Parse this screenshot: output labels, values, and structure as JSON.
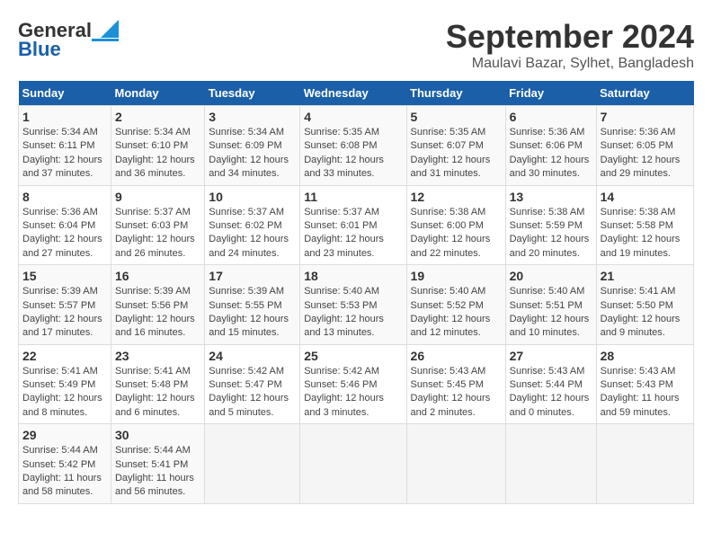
{
  "header": {
    "logo_general": "General",
    "logo_blue": "Blue",
    "title": "September 2024",
    "subtitle": "Maulavi Bazar, Sylhet, Bangladesh"
  },
  "days_of_week": [
    "Sunday",
    "Monday",
    "Tuesday",
    "Wednesday",
    "Thursday",
    "Friday",
    "Saturday"
  ],
  "weeks": [
    [
      {
        "day": "1",
        "sunrise": "Sunrise: 5:34 AM",
        "sunset": "Sunset: 6:11 PM",
        "daylight": "Daylight: 12 hours and 37 minutes."
      },
      {
        "day": "2",
        "sunrise": "Sunrise: 5:34 AM",
        "sunset": "Sunset: 6:10 PM",
        "daylight": "Daylight: 12 hours and 36 minutes."
      },
      {
        "day": "3",
        "sunrise": "Sunrise: 5:34 AM",
        "sunset": "Sunset: 6:09 PM",
        "daylight": "Daylight: 12 hours and 34 minutes."
      },
      {
        "day": "4",
        "sunrise": "Sunrise: 5:35 AM",
        "sunset": "Sunset: 6:08 PM",
        "daylight": "Daylight: 12 hours and 33 minutes."
      },
      {
        "day": "5",
        "sunrise": "Sunrise: 5:35 AM",
        "sunset": "Sunset: 6:07 PM",
        "daylight": "Daylight: 12 hours and 31 minutes."
      },
      {
        "day": "6",
        "sunrise": "Sunrise: 5:36 AM",
        "sunset": "Sunset: 6:06 PM",
        "daylight": "Daylight: 12 hours and 30 minutes."
      },
      {
        "day": "7",
        "sunrise": "Sunrise: 5:36 AM",
        "sunset": "Sunset: 6:05 PM",
        "daylight": "Daylight: 12 hours and 29 minutes."
      }
    ],
    [
      {
        "day": "8",
        "sunrise": "Sunrise: 5:36 AM",
        "sunset": "Sunset: 6:04 PM",
        "daylight": "Daylight: 12 hours and 27 minutes."
      },
      {
        "day": "9",
        "sunrise": "Sunrise: 5:37 AM",
        "sunset": "Sunset: 6:03 PM",
        "daylight": "Daylight: 12 hours and 26 minutes."
      },
      {
        "day": "10",
        "sunrise": "Sunrise: 5:37 AM",
        "sunset": "Sunset: 6:02 PM",
        "daylight": "Daylight: 12 hours and 24 minutes."
      },
      {
        "day": "11",
        "sunrise": "Sunrise: 5:37 AM",
        "sunset": "Sunset: 6:01 PM",
        "daylight": "Daylight: 12 hours and 23 minutes."
      },
      {
        "day": "12",
        "sunrise": "Sunrise: 5:38 AM",
        "sunset": "Sunset: 6:00 PM",
        "daylight": "Daylight: 12 hours and 22 minutes."
      },
      {
        "day": "13",
        "sunrise": "Sunrise: 5:38 AM",
        "sunset": "Sunset: 5:59 PM",
        "daylight": "Daylight: 12 hours and 20 minutes."
      },
      {
        "day": "14",
        "sunrise": "Sunrise: 5:38 AM",
        "sunset": "Sunset: 5:58 PM",
        "daylight": "Daylight: 12 hours and 19 minutes."
      }
    ],
    [
      {
        "day": "15",
        "sunrise": "Sunrise: 5:39 AM",
        "sunset": "Sunset: 5:57 PM",
        "daylight": "Daylight: 12 hours and 17 minutes."
      },
      {
        "day": "16",
        "sunrise": "Sunrise: 5:39 AM",
        "sunset": "Sunset: 5:56 PM",
        "daylight": "Daylight: 12 hours and 16 minutes."
      },
      {
        "day": "17",
        "sunrise": "Sunrise: 5:39 AM",
        "sunset": "Sunset: 5:55 PM",
        "daylight": "Daylight: 12 hours and 15 minutes."
      },
      {
        "day": "18",
        "sunrise": "Sunrise: 5:40 AM",
        "sunset": "Sunset: 5:53 PM",
        "daylight": "Daylight: 12 hours and 13 minutes."
      },
      {
        "day": "19",
        "sunrise": "Sunrise: 5:40 AM",
        "sunset": "Sunset: 5:52 PM",
        "daylight": "Daylight: 12 hours and 12 minutes."
      },
      {
        "day": "20",
        "sunrise": "Sunrise: 5:40 AM",
        "sunset": "Sunset: 5:51 PM",
        "daylight": "Daylight: 12 hours and 10 minutes."
      },
      {
        "day": "21",
        "sunrise": "Sunrise: 5:41 AM",
        "sunset": "Sunset: 5:50 PM",
        "daylight": "Daylight: 12 hours and 9 minutes."
      }
    ],
    [
      {
        "day": "22",
        "sunrise": "Sunrise: 5:41 AM",
        "sunset": "Sunset: 5:49 PM",
        "daylight": "Daylight: 12 hours and 8 minutes."
      },
      {
        "day": "23",
        "sunrise": "Sunrise: 5:41 AM",
        "sunset": "Sunset: 5:48 PM",
        "daylight": "Daylight: 12 hours and 6 minutes."
      },
      {
        "day": "24",
        "sunrise": "Sunrise: 5:42 AM",
        "sunset": "Sunset: 5:47 PM",
        "daylight": "Daylight: 12 hours and 5 minutes."
      },
      {
        "day": "25",
        "sunrise": "Sunrise: 5:42 AM",
        "sunset": "Sunset: 5:46 PM",
        "daylight": "Daylight: 12 hours and 3 minutes."
      },
      {
        "day": "26",
        "sunrise": "Sunrise: 5:43 AM",
        "sunset": "Sunset: 5:45 PM",
        "daylight": "Daylight: 12 hours and 2 minutes."
      },
      {
        "day": "27",
        "sunrise": "Sunrise: 5:43 AM",
        "sunset": "Sunset: 5:44 PM",
        "daylight": "Daylight: 12 hours and 0 minutes."
      },
      {
        "day": "28",
        "sunrise": "Sunrise: 5:43 AM",
        "sunset": "Sunset: 5:43 PM",
        "daylight": "Daylight: 11 hours and 59 minutes."
      }
    ],
    [
      {
        "day": "29",
        "sunrise": "Sunrise: 5:44 AM",
        "sunset": "Sunset: 5:42 PM",
        "daylight": "Daylight: 11 hours and 58 minutes."
      },
      {
        "day": "30",
        "sunrise": "Sunrise: 5:44 AM",
        "sunset": "Sunset: 5:41 PM",
        "daylight": "Daylight: 11 hours and 56 minutes."
      },
      null,
      null,
      null,
      null,
      null
    ]
  ]
}
